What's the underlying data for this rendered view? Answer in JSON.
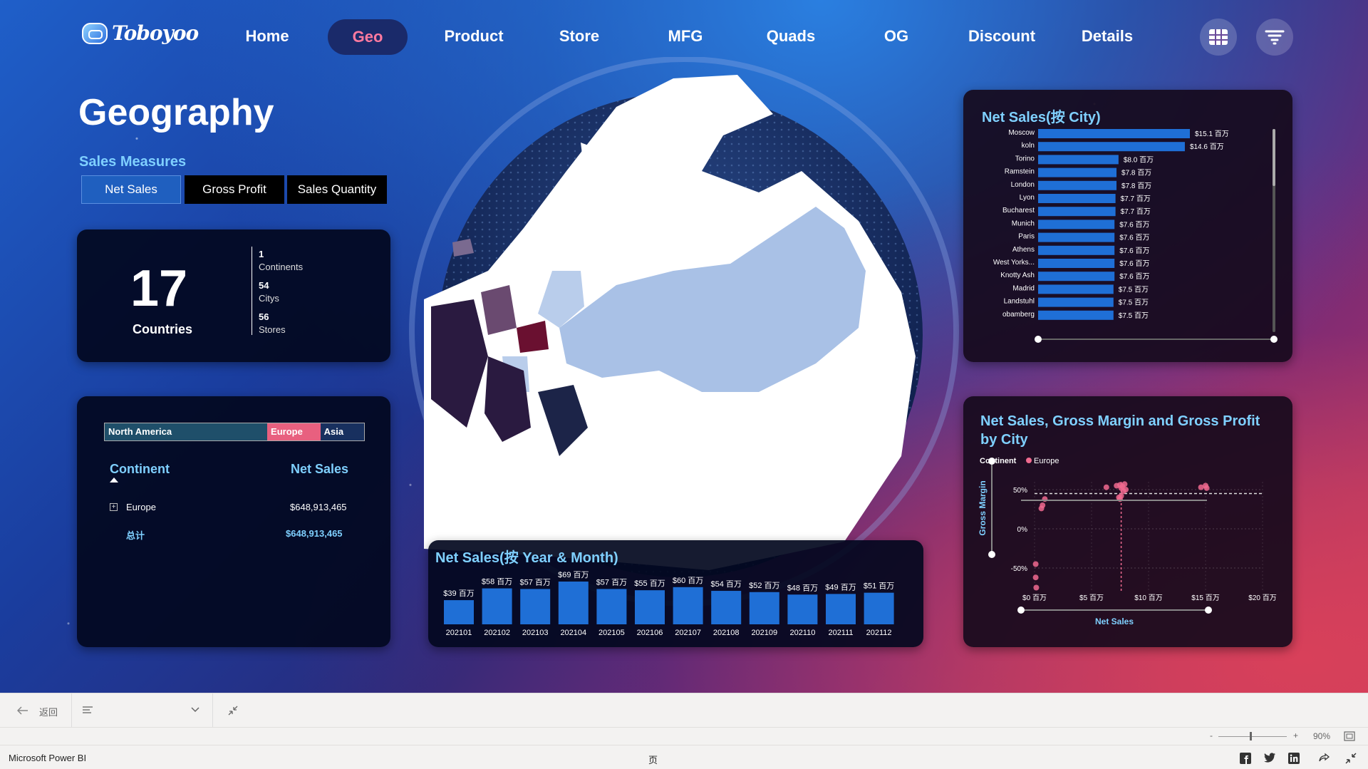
{
  "app": {
    "logo_text": "Toboyoo"
  },
  "nav": {
    "items": [
      {
        "label": "Home"
      },
      {
        "label": "Geo"
      },
      {
        "label": "Product"
      },
      {
        "label": "Store"
      },
      {
        "label": "MFG"
      },
      {
        "label": "Quads"
      },
      {
        "label": "OG"
      },
      {
        "label": "Discount"
      },
      {
        "label": "Details"
      }
    ],
    "active": "Geo",
    "active_color": "#ff7aa0"
  },
  "page": {
    "title": "Geography"
  },
  "measures": {
    "label": "Sales Measures",
    "buttons": [
      "Net Sales",
      "Gross Profit",
      "Sales Quantity"
    ],
    "selected": "Net Sales"
  },
  "kpi": {
    "countries_value": "17",
    "countries_label": "Countries",
    "continents_value": "1",
    "continents_label": "Continents",
    "citys_value": "54",
    "citys_label": "Citys",
    "stores_value": "56",
    "stores_label": "Stores"
  },
  "continent_table": {
    "bar": [
      {
        "label": "North America",
        "share": 0.52,
        "color": "#1f4f6a"
      },
      {
        "label": "Europe",
        "share": 0.17,
        "color": "#e8607f"
      },
      {
        "label": "Asia",
        "share": 0.14,
        "color": "#18305f"
      }
    ],
    "col_continent": "Continent",
    "col_net_sales": "Net Sales",
    "rows": [
      {
        "continent": "Europe",
        "net_sales": "$648,913,465"
      }
    ],
    "total_label": "总计",
    "total_value": "$648,913,465"
  },
  "chart_data": [
    {
      "type": "bar",
      "orientation": "horizontal",
      "title": "Net Sales(按 City)",
      "categories": [
        "Moscow",
        "koln",
        "Torino",
        "Ramstein",
        "London",
        "Lyon",
        "Bucharest",
        "Munich",
        "Paris",
        "Athens",
        "West Yorks...",
        "Knotty Ash",
        "Madrid",
        "Landstuhl",
        "obamberg"
      ],
      "values": [
        15.1,
        14.6,
        8.0,
        7.8,
        7.8,
        7.7,
        7.7,
        7.6,
        7.6,
        7.6,
        7.6,
        7.6,
        7.5,
        7.5,
        7.5
      ],
      "data_labels": [
        "$15.1 百万",
        "$14.6 百万",
        "$8.0 百万",
        "$7.8 百万",
        "$7.8 百万",
        "$7.7 百万",
        "$7.7 百万",
        "$7.6 百万",
        "$7.6 百万",
        "$7.6 百万",
        "$7.6 百万",
        "$7.6 百万",
        "$7.5 百万",
        "$7.5 百万",
        "$7.5 百万"
      ],
      "unit": "百万",
      "color": "#1f6fd6"
    },
    {
      "type": "bar",
      "title": "Net Sales(按 Year & Month)",
      "categories": [
        "202101",
        "202102",
        "202103",
        "202104",
        "202105",
        "202106",
        "202107",
        "202108",
        "202109",
        "202110",
        "202111",
        "202112"
      ],
      "values": [
        39,
        58,
        57,
        69,
        57,
        55,
        60,
        54,
        52,
        48,
        49,
        51
      ],
      "data_labels": [
        "$39 百万",
        "$58 百万",
        "$57 百万",
        "$69 百万",
        "$57 百万",
        "$55 百万",
        "$60 百万",
        "$54 百万",
        "$52 百万",
        "$48 百万",
        "$49 百万",
        "$51 百万"
      ],
      "unit": "百万",
      "color": "#1f6fd6"
    },
    {
      "type": "scatter",
      "title": "Net Sales, Gross Margin and Gross Profit by City",
      "legend_title": "Continent",
      "series": [
        {
          "name": "Europe",
          "color": "#f06a8f",
          "points": [
            {
              "x": 0.7,
              "y": 30
            },
            {
              "x": 0.9,
              "y": 38
            },
            {
              "x": 0.6,
              "y": 26
            },
            {
              "x": 0.1,
              "y": -45
            },
            {
              "x": 0.1,
              "y": -62
            },
            {
              "x": 0.15,
              "y": -75
            },
            {
              "x": 6.3,
              "y": 53
            },
            {
              "x": 7.2,
              "y": 55
            },
            {
              "x": 7.5,
              "y": 56
            },
            {
              "x": 7.6,
              "y": 52
            },
            {
              "x": 7.7,
              "y": 54
            },
            {
              "x": 7.8,
              "y": 48
            },
            {
              "x": 7.6,
              "y": 42
            },
            {
              "x": 7.4,
              "y": 40
            },
            {
              "x": 7.9,
              "y": 57
            },
            {
              "x": 8.0,
              "y": 50
            },
            {
              "x": 7.5,
              "y": 38
            },
            {
              "x": 14.6,
              "y": 53
            },
            {
              "x": 15.1,
              "y": 52
            },
            {
              "x": 15.0,
              "y": 55
            }
          ]
        }
      ],
      "reference_x": 7.6,
      "reference_y": 45,
      "xlabel": "Net Sales",
      "ylabel": "Gross Margin",
      "x_ticks": [
        "$0 百万",
        "$5 百万",
        "$10 百万",
        "$15 百万",
        "$20 百万"
      ],
      "y_ticks": [
        "50%",
        "0%",
        "-50%"
      ],
      "xlim": [
        0,
        20
      ],
      "ylim": [
        -80,
        60
      ]
    }
  ],
  "toolbar": {
    "back_label": "返回"
  },
  "status": {
    "zoom": "90%",
    "minus": "-",
    "plus": "+"
  },
  "footer": {
    "app_name": "Microsoft Power BI",
    "page_label": "页"
  }
}
